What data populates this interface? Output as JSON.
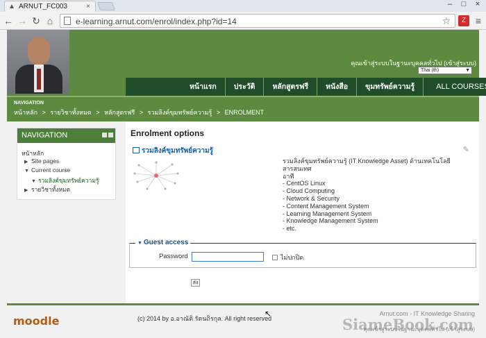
{
  "browser": {
    "tab_title": "ARNUT_FC003",
    "url": "e-learning.arnut.com/enrol/index.php?id=14",
    "extension_label": "Z"
  },
  "header": {
    "login_info": "คุณเข้าสู่ระบบในฐานะบุคคลทั่วไป (เข้าสู่ระบบ)",
    "language": "Thai (th)",
    "menu": [
      "หน้าแรก",
      "ประวัติ",
      "หลักสูตรฟรี",
      "หนังสือ",
      "ขุมทรัพย์ความรู้",
      "ALL COURSES"
    ]
  },
  "navbar": {
    "title": "NAVIGATION",
    "crumbs": [
      "หน้าหลัก",
      ">",
      "รายวิชาทั้งหมด",
      ">",
      "หลักสูตรฟรี",
      ">",
      "รวมลิงค์ขุมทรัพย์ความรู้",
      ">",
      "ENROLMENT"
    ]
  },
  "nav_block": {
    "title": "NAVIGATION",
    "home": "หน้าหลัก",
    "site_pages": "Site pages",
    "current_course": "Current course",
    "course": "รวมลิงค์ขุมทรัพย์ความรู้",
    "all_courses": "รายวิชาทั้งหมด"
  },
  "main": {
    "title": "Enrolment options",
    "course_name": "รวมลิงค์ขุมทรัพย์ความรู้",
    "summary_intro": "รวมลิงค์ขุมทรัพย์ความรู้ (IT Knowledge Asset) ด้านเทคโนโลยีสารสนเทศ",
    "summary_lines": [
      "อาที",
      "- CentOS Linux",
      "- Cloud Computing",
      "- Network & Security",
      "- Content Management System",
      "- Learning Management System",
      "- Knowledge Management System",
      "- etc."
    ],
    "guest_access": "Guest access",
    "password_label": "Password",
    "unmask_label": "ไม่ปกปิด",
    "submit_label": "ส่ง"
  },
  "footer": {
    "logo": "moodle",
    "copyright": "(c) 2014 by อ.อาณัติ รัตนถิรกุล. All right reserved",
    "site_name": "Arnut.com - IT Knowledge Sharing",
    "login_info": "คุณเข้าสู่ระบบในฐานะบุคคลทั่วไป (เข้าสู่ระบบ)",
    "watermark": "SiameBook.com"
  },
  "colors": {
    "header_green": "#5e8a3f",
    "menu_dark_green": "#1f4d2a",
    "block_header": "#4d7e3a",
    "link_blue": "#1a5f9f"
  }
}
